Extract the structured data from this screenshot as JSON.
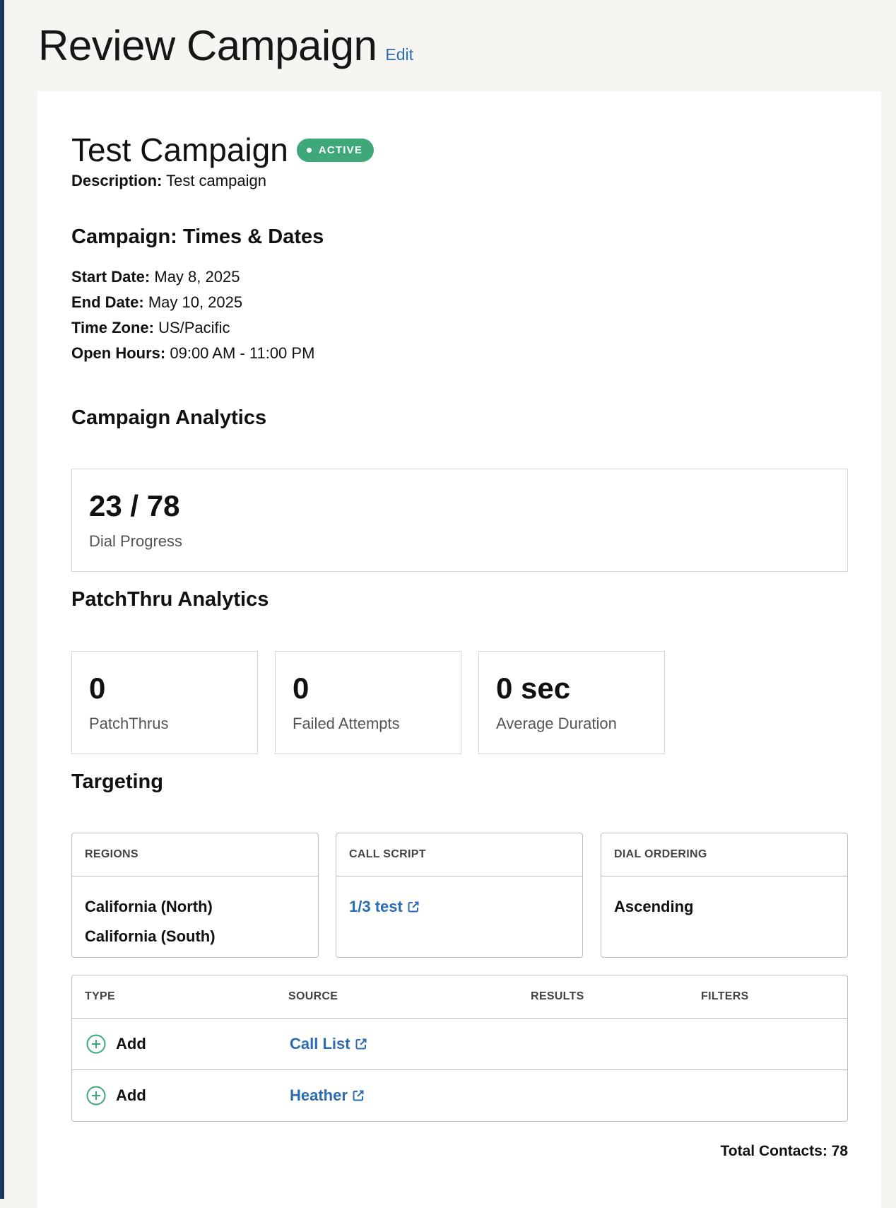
{
  "page": {
    "title": "Review Campaign",
    "edit_label": "Edit"
  },
  "campaign": {
    "name": "Test Campaign",
    "status": "ACTIVE",
    "status_color": "#3ea87b",
    "description_label": "Description:",
    "description": "Test campaign"
  },
  "times": {
    "heading": "Campaign: Times & Dates",
    "start_label": "Start Date:",
    "start": "May 8, 2025",
    "end_label": "End Date:",
    "end": "May 10, 2025",
    "tz_label": "Time Zone:",
    "tz": "US/Pacific",
    "hours_label": "Open Hours:",
    "hours": "09:00 AM - 11:00 PM"
  },
  "analytics": {
    "heading": "Campaign Analytics",
    "dial_progress_value": "23 / 78",
    "dial_progress_label": "Dial Progress"
  },
  "patchthru": {
    "heading": "PatchThru Analytics",
    "stats": [
      {
        "value": "0",
        "label": "PatchThrus"
      },
      {
        "value": "0",
        "label": "Failed Attempts"
      },
      {
        "value": "0 sec",
        "label": "Average Duration"
      }
    ]
  },
  "targeting": {
    "heading": "Targeting",
    "regions_header": "REGIONS",
    "regions": [
      "California (North)",
      "California (South)"
    ],
    "script_header": "CALL SCRIPT",
    "script_link": "1/3 test",
    "ordering_header": "DIAL ORDERING",
    "ordering": "Ascending",
    "table": {
      "headers": [
        "TYPE",
        "SOURCE",
        "RESULTS",
        "FILTERS"
      ],
      "rows": [
        {
          "type": "Add",
          "source": "Call List"
        },
        {
          "type": "Add",
          "source": "Heather"
        }
      ]
    },
    "total_contacts": "Total Contacts: 78"
  },
  "colors": {
    "link": "#2b6cb0",
    "accent": "#3ea87b"
  },
  "icons": {
    "external_link": "external-link-icon",
    "add": "plus-circle-icon"
  }
}
